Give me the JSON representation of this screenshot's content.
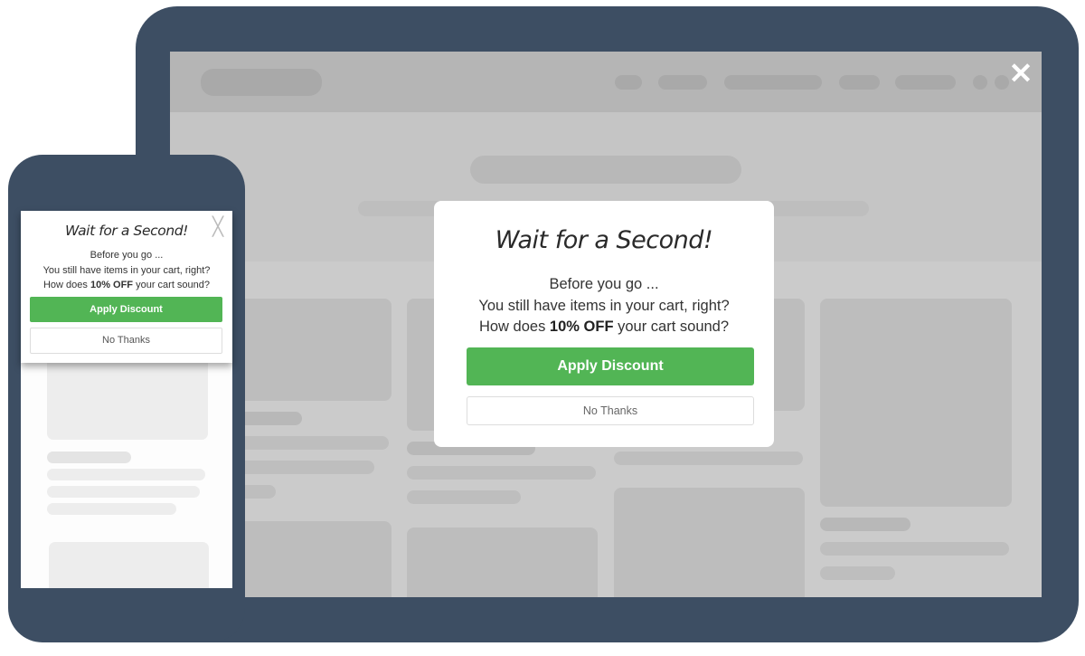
{
  "desktop": {
    "close_icon_glyph": "✕",
    "popup": {
      "title": "Wait for a Second!",
      "line1": "Before you go ...",
      "line2": "You still have items in your cart, right?",
      "line3_pre": "How does ",
      "line3_bold": "10% OFF",
      "line3_post": " your cart sound?",
      "apply_label": "Apply Discount",
      "decline_label": "No Thanks"
    }
  },
  "mobile": {
    "close_icon_glyph": "╳",
    "popup": {
      "title": "Wait for a Second!",
      "line1": "Before you go ...",
      "line2": "You still have items in your cart, right?",
      "line3_pre": "How does ",
      "line3_bold": "10% OFF",
      "line3_post": " your cart sound?",
      "apply_label": "Apply Discount",
      "decline_label": "No Thanks"
    }
  },
  "colors": {
    "device_frame": "#3d4e63",
    "accent_green": "#52b555",
    "placeholder_gray": "#bdbdbd"
  }
}
